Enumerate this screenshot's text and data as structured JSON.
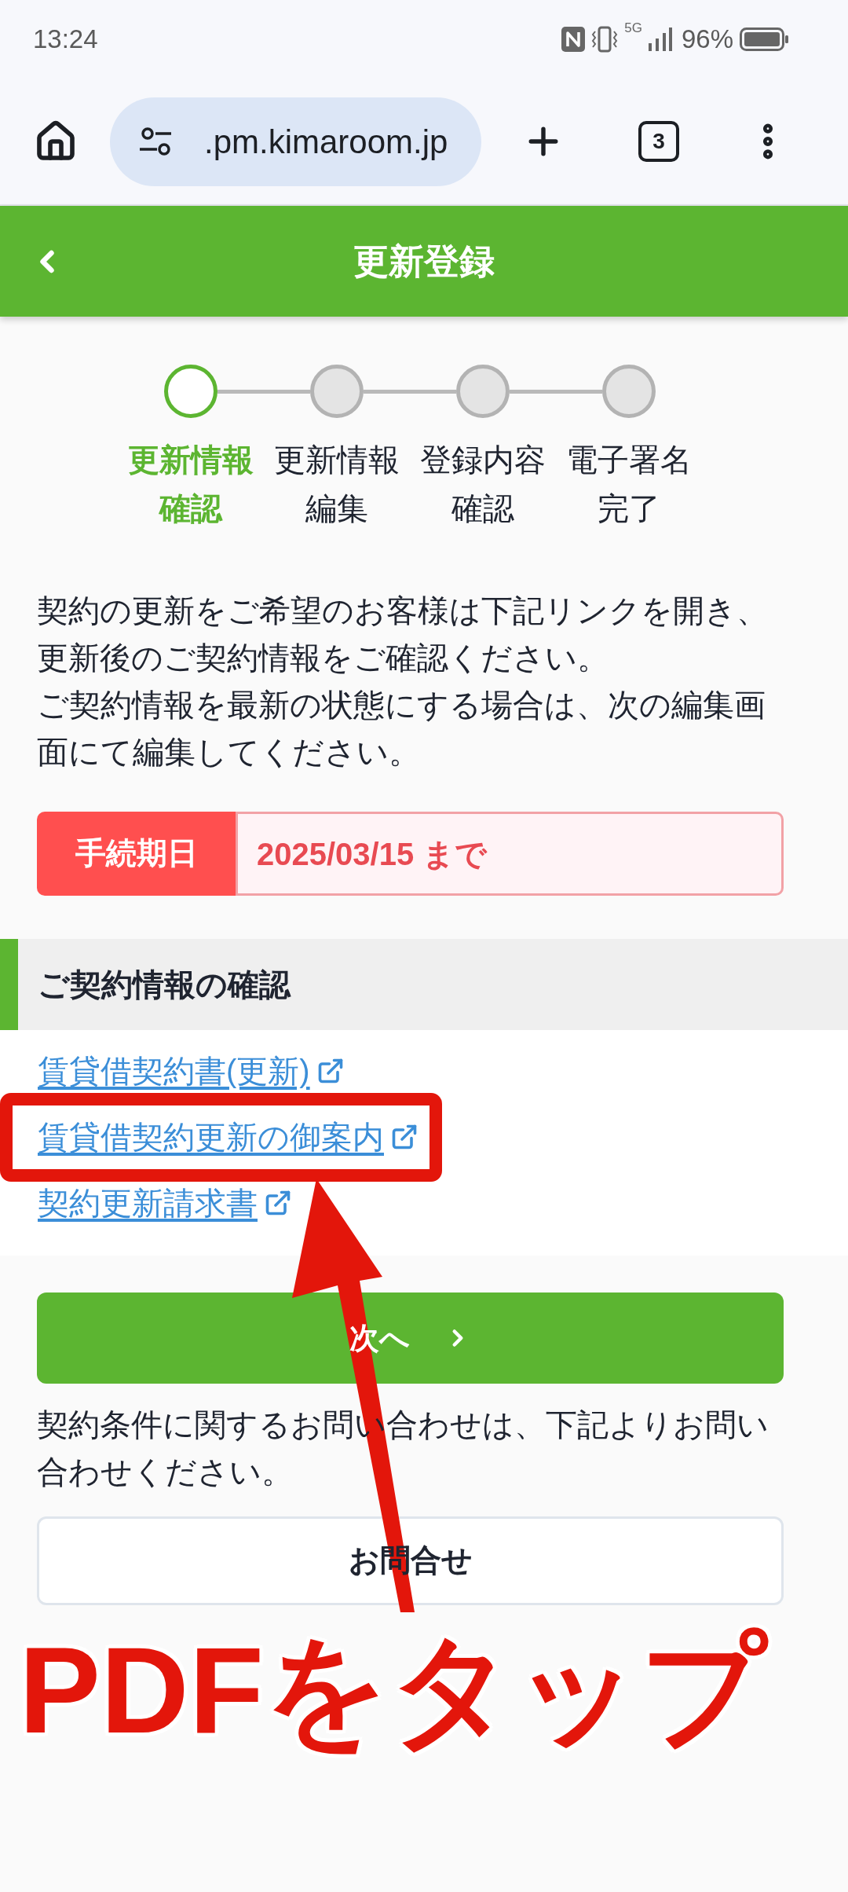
{
  "status_bar": {
    "time": "13:24",
    "network": "5G",
    "battery": "96%"
  },
  "browser_bar": {
    "url": ".pm.kimaroom.jp",
    "tab_count": "3"
  },
  "header": {
    "title": "更新登録"
  },
  "steps": [
    {
      "lines": [
        "更新情報",
        "確認"
      ],
      "selected": true
    },
    {
      "lines": [
        "更新情報",
        "編集"
      ],
      "selected": false
    },
    {
      "lines": [
        "登録内容",
        "確認"
      ],
      "selected": false
    },
    {
      "lines": [
        "電子署名",
        "完了"
      ],
      "selected": false
    }
  ],
  "intro": [
    "契約の更新をご希望のお客様は下記リンクを開き、更新後のご契約情報をご確認ください。",
    "ご契約情報を最新の状態にする場合は、次の編集画面にて編集してください。"
  ],
  "deadline": {
    "label": "手続期日",
    "value": "2025/03/15 まで"
  },
  "contract_section": {
    "title": "ご契約情報の確認",
    "links": [
      {
        "label": "賃貸借契約書(更新)",
        "highlighted": false
      },
      {
        "label": "賃貸借契約更新の御案内",
        "highlighted": true
      },
      {
        "label": "契約更新請求書",
        "highlighted": false
      }
    ]
  },
  "next_button": {
    "label": "次へ"
  },
  "contact_note": "契約条件に関するお問い合わせは、下記よりお問い合わせください。",
  "contact_button": {
    "label": "お問合せ"
  },
  "annotation": {
    "caption": "PDFをタップ"
  }
}
